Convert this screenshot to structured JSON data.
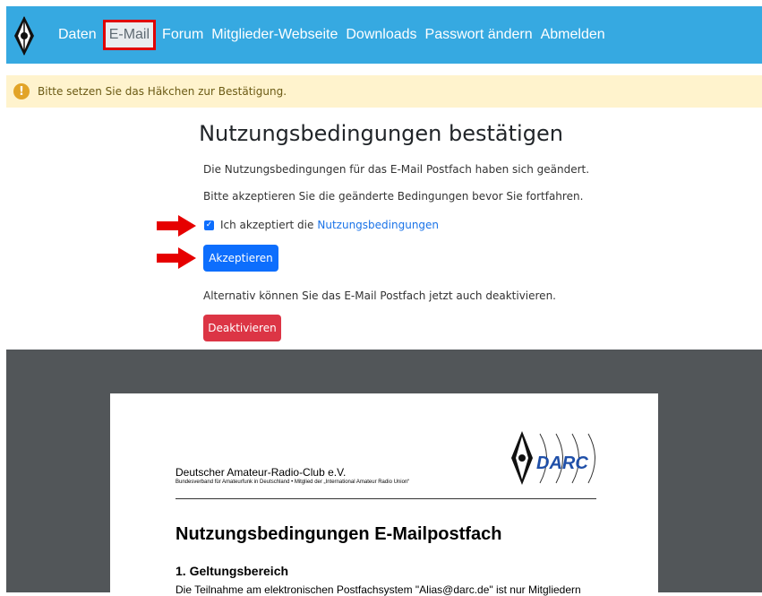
{
  "nav": {
    "items": [
      {
        "label": "Daten"
      },
      {
        "label": "E-Mail",
        "active": true
      },
      {
        "label": "Forum"
      },
      {
        "label": "Mitglieder-Webseite"
      },
      {
        "label": "Downloads"
      },
      {
        "label": "Passwort ändern"
      },
      {
        "label": "Abmelden"
      }
    ],
    "logo_icon": "darc-diamond-logo-icon"
  },
  "alert": {
    "icon": "warning-icon",
    "text": "Bitte setzen Sie das Häkchen zur Bestätigung."
  },
  "main": {
    "title": "Nutzungsbedingungen bestätigen",
    "paragraph1": "Die Nutzungsbedingungen für das E-Mail Postfach haben sich geändert.",
    "paragraph2": "Bitte akzeptieren Sie die geänderte Bedingungen bevor Sie fortfahren.",
    "checkbox_label": "Ich akzeptiert die",
    "checkbox_checked": true,
    "terms_link": "Nutzungsbedingungen",
    "accept_button": "Akzeptieren",
    "alt_text": "Alternativ können Sie das E-Mail Postfach jetzt auch deaktivieren.",
    "deactivate_button": "Deaktivieren"
  },
  "document": {
    "org_name": "Deutscher Amateur-Radio-Club e.V.",
    "org_sub": "Bundesverband für Amateurfunk in Deutschland • Mitglied der „International Amateur Radio Union“",
    "logo_text": "DARC",
    "title": "Nutzungsbedingungen E-Mailpostfach",
    "section1_heading": "1. Geltungsbereich",
    "section1_text": "Die Teilnahme am elektronischen Postfachsystem \"Alias@darc.de\" ist nur Mitgliedern"
  },
  "colors": {
    "navbar": "#36a9e1",
    "alert_bg": "#fff3cd",
    "primary": "#0d6efd",
    "danger": "#dc3545",
    "highlight": "#e00000",
    "viewer_bg": "#525659"
  }
}
